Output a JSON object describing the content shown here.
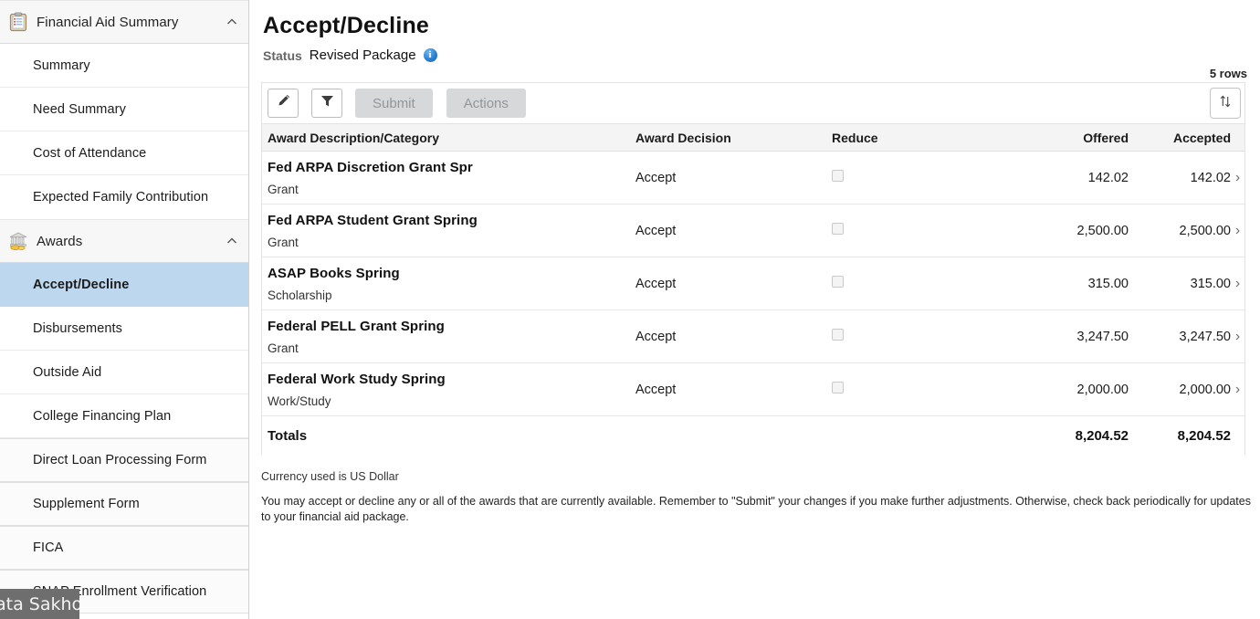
{
  "sidebar": {
    "groups": [
      {
        "icon": "clipboard-icon",
        "label": "Financial Aid Summary",
        "collapse_icon": "chevron-up-icon",
        "items": [
          {
            "label": "Summary"
          },
          {
            "label": "Need Summary"
          },
          {
            "label": "Cost of Attendance"
          },
          {
            "label": "Expected Family Contribution"
          }
        ]
      },
      {
        "icon": "bank-coins-icon",
        "label": "Awards",
        "collapse_icon": "chevron-up-icon",
        "items": [
          {
            "label": "Accept/Decline"
          },
          {
            "label": "Disbursements"
          },
          {
            "label": "Outside Aid"
          },
          {
            "label": "College Financing Plan"
          },
          {
            "label": "Direct Loan Processing Form"
          },
          {
            "label": "Supplement Form"
          },
          {
            "label": "FICA"
          },
          {
            "label": "SNAP Enrollment Verification"
          }
        ]
      }
    ],
    "selected_item": "Accept/Decline",
    "selected_color": "#bdd7ee"
  },
  "header": {
    "title": "Accept/Decline",
    "status_label": "Status",
    "status_value": "Revised Package",
    "info_icon": "info-icon"
  },
  "toolbar": {
    "edit_icon": "pencil-icon",
    "filter_icon": "filter-icon",
    "submit_label": "Submit",
    "actions_label": "Actions",
    "sort_icon": "sort-updown-icon",
    "rows_count": "5 rows"
  },
  "table": {
    "columns": [
      "Award Description/Category",
      "Award Decision",
      "Reduce",
      "Offered",
      "Accepted"
    ],
    "rows": [
      {
        "name": "Fed ARPA Discretion Grant Spr",
        "category": "Grant",
        "decision": "Accept",
        "reduce_checked": false,
        "offered": "142.02",
        "accepted": "142.02",
        "detail_icon": "chevron-right-icon"
      },
      {
        "name": "Fed ARPA Student Grant Spring",
        "category": "Grant",
        "decision": "Accept",
        "reduce_checked": false,
        "offered": "2,500.00",
        "accepted": "2,500.00",
        "detail_icon": "chevron-right-icon"
      },
      {
        "name": "ASAP Books Spring",
        "category": "Scholarship",
        "decision": "Accept",
        "reduce_checked": false,
        "offered": "315.00",
        "accepted": "315.00",
        "detail_icon": "chevron-right-icon"
      },
      {
        "name": "Federal PELL Grant Spring",
        "category": "Grant",
        "decision": "Accept",
        "reduce_checked": false,
        "offered": "3,247.50",
        "accepted": "3,247.50",
        "detail_icon": "chevron-right-icon"
      },
      {
        "name": "Federal Work Study Spring",
        "category": "Work/Study",
        "decision": "Accept",
        "reduce_checked": false,
        "offered": "2,000.00",
        "accepted": "2,000.00",
        "detail_icon": "chevron-right-icon"
      }
    ],
    "totals": {
      "label": "Totals",
      "offered": "8,204.52",
      "accepted": "8,204.52"
    }
  },
  "footer": {
    "currency_note": "Currency used is US Dollar",
    "helper_text": "You may accept or decline any or all of the awards that are currently available. Remember to \"Submit\" your changes if you make further adjustments. Otherwise, check back periodically for updates to your financial aid package."
  },
  "overlay": {
    "watermark_text": "ata Sakho"
  }
}
